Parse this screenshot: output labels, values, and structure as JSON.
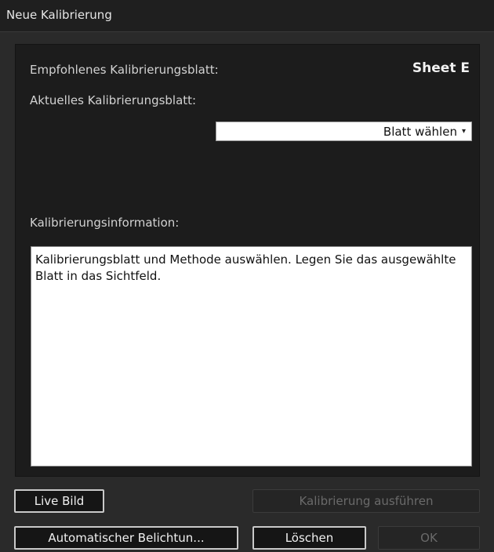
{
  "window": {
    "title": "Neue Kalibrierung"
  },
  "labels": {
    "recommended": "Empfohlenes Kalibrierungsblatt:",
    "current": "Aktuelles Kalibrierungsblatt:",
    "info": "Kalibrierungsinformation:"
  },
  "recommended_value": "Sheet E",
  "sheet_select": {
    "value": "Blatt wählen",
    "caret": "▾"
  },
  "info_text": "Kalibrierungsblatt und Methode auswählen. Legen Sie das ausgewählte Blatt in das Sichtfeld.",
  "buttons": {
    "live": "Live Bild",
    "run": "Kalibrierung ausführen",
    "auto_exposure": "Automatischer Belichtun...",
    "delete": "Löschen",
    "ok": "OK"
  }
}
